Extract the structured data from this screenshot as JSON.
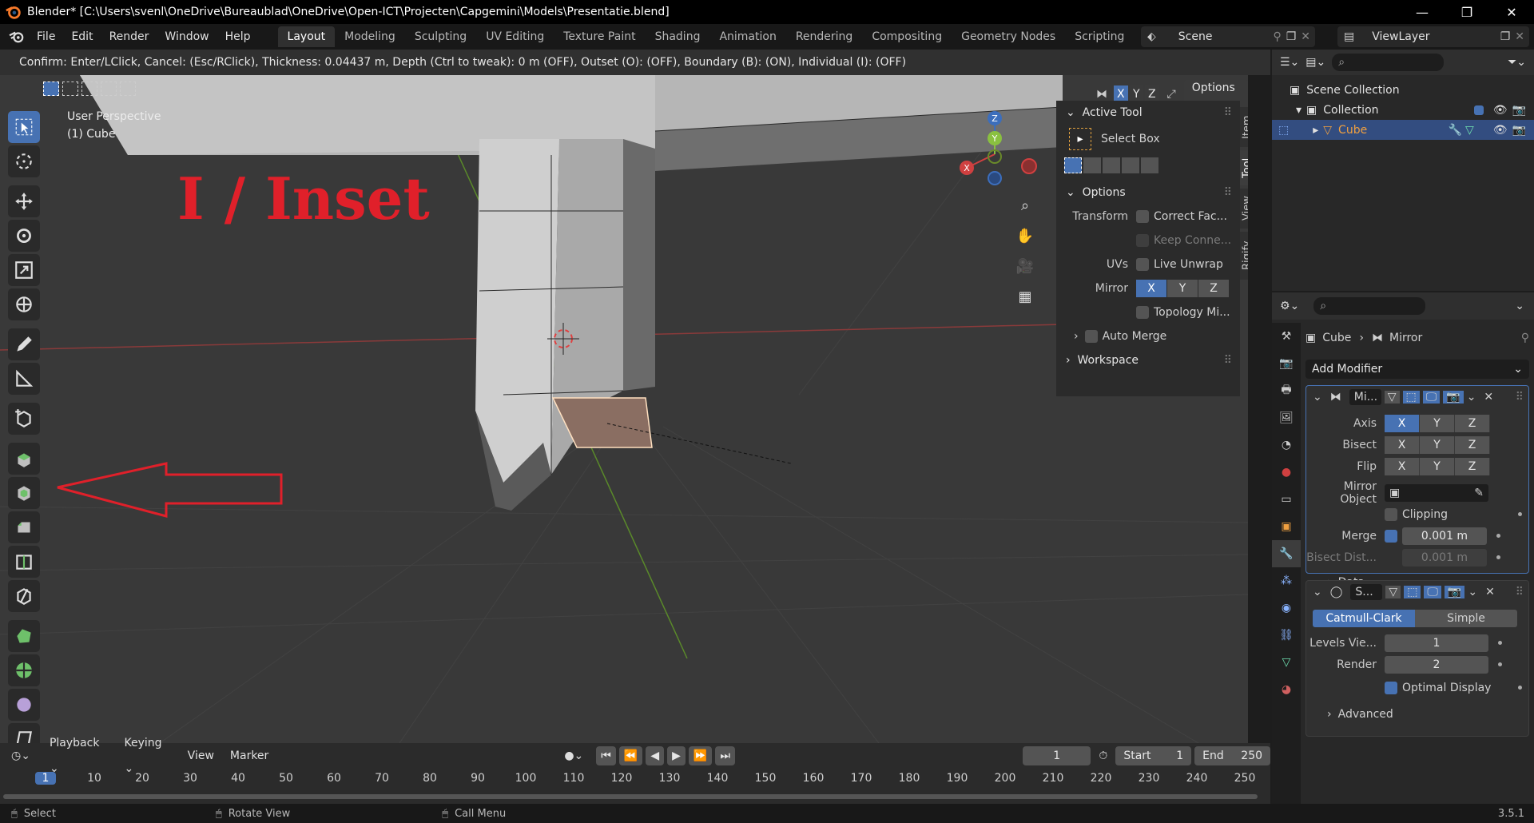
{
  "window": {
    "title": "Blender* [C:\\Users\\svenl\\OneDrive\\Bureaublad\\OneDrive\\Open-ICT\\Projecten\\Capgemini\\Models\\Presentatie.blend]",
    "minimize": "—",
    "maximize": "❐",
    "close": "✕"
  },
  "menu": [
    "File",
    "Edit",
    "Render",
    "Window",
    "Help"
  ],
  "workspaces": [
    "Layout",
    "Modeling",
    "Sculpting",
    "UV Editing",
    "Texture Paint",
    "Shading",
    "Animation",
    "Rendering",
    "Compositing",
    "Geometry Nodes",
    "Scripting"
  ],
  "active_workspace": "Layout",
  "add_workspace": "+",
  "scene": {
    "label": "Scene"
  },
  "view_layer": {
    "label": "ViewLayer"
  },
  "confirm_text": "Confirm: Enter/LClick, Cancel: (Esc/RClick), Thickness: 0.04437 m, Depth (Ctrl to tweak): 0 m (OFF), Outset (O): (OFF), Boundary (B): (ON), Individual (I): (OFF)",
  "viewport": {
    "perspective": "User Perspective",
    "object": "(1) Cube",
    "annotation": "I / Inset",
    "options_label": "Options",
    "axis_x": "X",
    "axis_y": "Y",
    "axis_z": "Z"
  },
  "npanel": {
    "tabs": [
      "Item",
      "Tool",
      "View",
      "Rigify"
    ],
    "active_tab": "Tool",
    "active_tool_header": "Active Tool",
    "active_tool_name": "Select Box",
    "options_header": "Options",
    "transform_label": "Transform",
    "correct_faces": "Correct Fac...",
    "keep_connected": "Keep Conne...",
    "uvs_label": "UVs",
    "live_unwrap": "Live Unwrap",
    "mirror_label": "Mirror",
    "mirror_axes": [
      "X",
      "Y",
      "Z"
    ],
    "topology_mirror": "Topology Mi...",
    "auto_merge": "Auto Merge",
    "workspace_header": "Workspace"
  },
  "outliner": {
    "scene_collection": "Scene Collection",
    "collection": "Collection",
    "cube": "Cube"
  },
  "properties": {
    "breadcrumb_object": "Cube",
    "breadcrumb_modifier": "Mirror",
    "add_modifier": "Add Modifier",
    "mirror_mod": {
      "name": "Mi...",
      "axis_label": "Axis",
      "bisect_label": "Bisect",
      "flip_label": "Flip",
      "axes": [
        "X",
        "Y",
        "Z"
      ],
      "mirror_object_label": "Mirror Object",
      "clipping": "Clipping",
      "merge_label": "Merge",
      "merge_value": "0.001 m",
      "bisect_dist_label": "Bisect Dist...",
      "bisect_dist_value": "0.001 m",
      "data": "Data"
    },
    "subsurf_mod": {
      "name": "S...",
      "catmull": "Catmull-Clark",
      "simple": "Simple",
      "levels_label": "Levels Vie...",
      "levels_value": "1",
      "render_label": "Render",
      "render_value": "2",
      "optimal_display": "Optimal Display",
      "advanced": "Advanced"
    }
  },
  "timeline": {
    "playback": "Playback",
    "keying": "Keying",
    "view": "View",
    "marker": "Marker",
    "current_frame": "1",
    "start_label": "Start",
    "start_value": "1",
    "end_label": "End",
    "end_value": "250",
    "ruler": [
      "1",
      "10",
      "20",
      "30",
      "40",
      "50",
      "60",
      "70",
      "80",
      "90",
      "100",
      "110",
      "120",
      "130",
      "140",
      "150",
      "160",
      "170",
      "180",
      "190",
      "200",
      "210",
      "220",
      "230",
      "240",
      "250"
    ]
  },
  "status": {
    "select": "Select",
    "rotate": "Rotate View",
    "call_menu": "Call Menu",
    "version": "3.5.1"
  },
  "colors": {
    "accent": "#4772b3",
    "annotation_red": "#e0202a",
    "viewport_bg": "#393939"
  }
}
